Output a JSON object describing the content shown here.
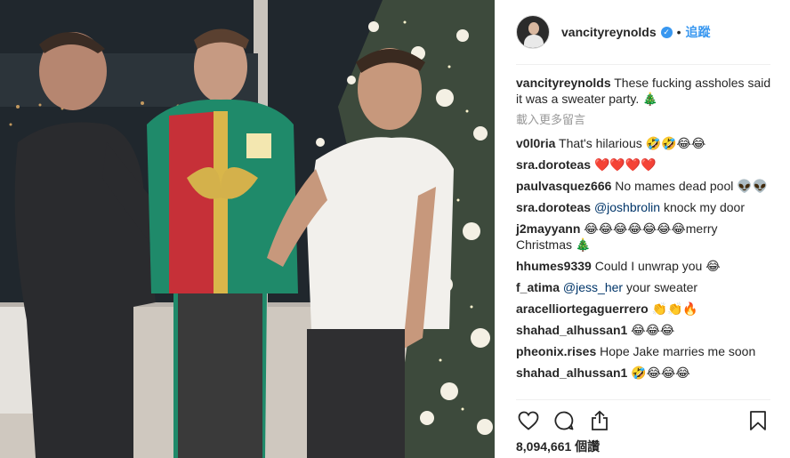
{
  "header": {
    "username": "vancityreynolds",
    "verified_mark": "✓",
    "separator": "•",
    "follow_label": "追蹤"
  },
  "caption": {
    "username": "vancityreynolds",
    "text": "These fucking assholes said it was a sweater party. 🎄"
  },
  "load_more_label": "載入更多留言",
  "comments": [
    {
      "user": "v0l0ria",
      "text": "That's hilarious 🤣🤣😂😂"
    },
    {
      "user": "sra.doroteas",
      "text": "❤️❤️❤️❤️"
    },
    {
      "user": "paulvasquez666",
      "text": "No mames dead pool 👽👽"
    },
    {
      "user": "sra.doroteas",
      "mention": "@joshbrolin",
      "text": " knock my door"
    },
    {
      "user": "j2mayyann",
      "text": "😂😂😂😂😂😂😂merry Christmas 🎄"
    },
    {
      "user": "hhumes9339",
      "text": "Could I unwrap you 😂"
    },
    {
      "user": "f_atima",
      "mention": "@jess_her",
      "text": " your sweater"
    },
    {
      "user": "aracelliortegaguerrero",
      "text": "👏👏🔥"
    },
    {
      "user": "shahad_alhussan1",
      "text": "😂😂😂"
    },
    {
      "user": "pheonix.rises",
      "text": "Hope Jake marries me soon"
    },
    {
      "user": "shahad_alhussan1",
      "text": "🤣😂😂😂"
    }
  ],
  "actions": {
    "like_icon": "heart-icon",
    "comment_icon": "comment-icon",
    "share_icon": "share-icon",
    "save_icon": "bookmark-icon"
  },
  "views": "8,094,661 個讚",
  "colors": {
    "link_blue": "#3897f0",
    "mention_blue": "#003569",
    "muted": "#999999",
    "text": "#262626"
  }
}
